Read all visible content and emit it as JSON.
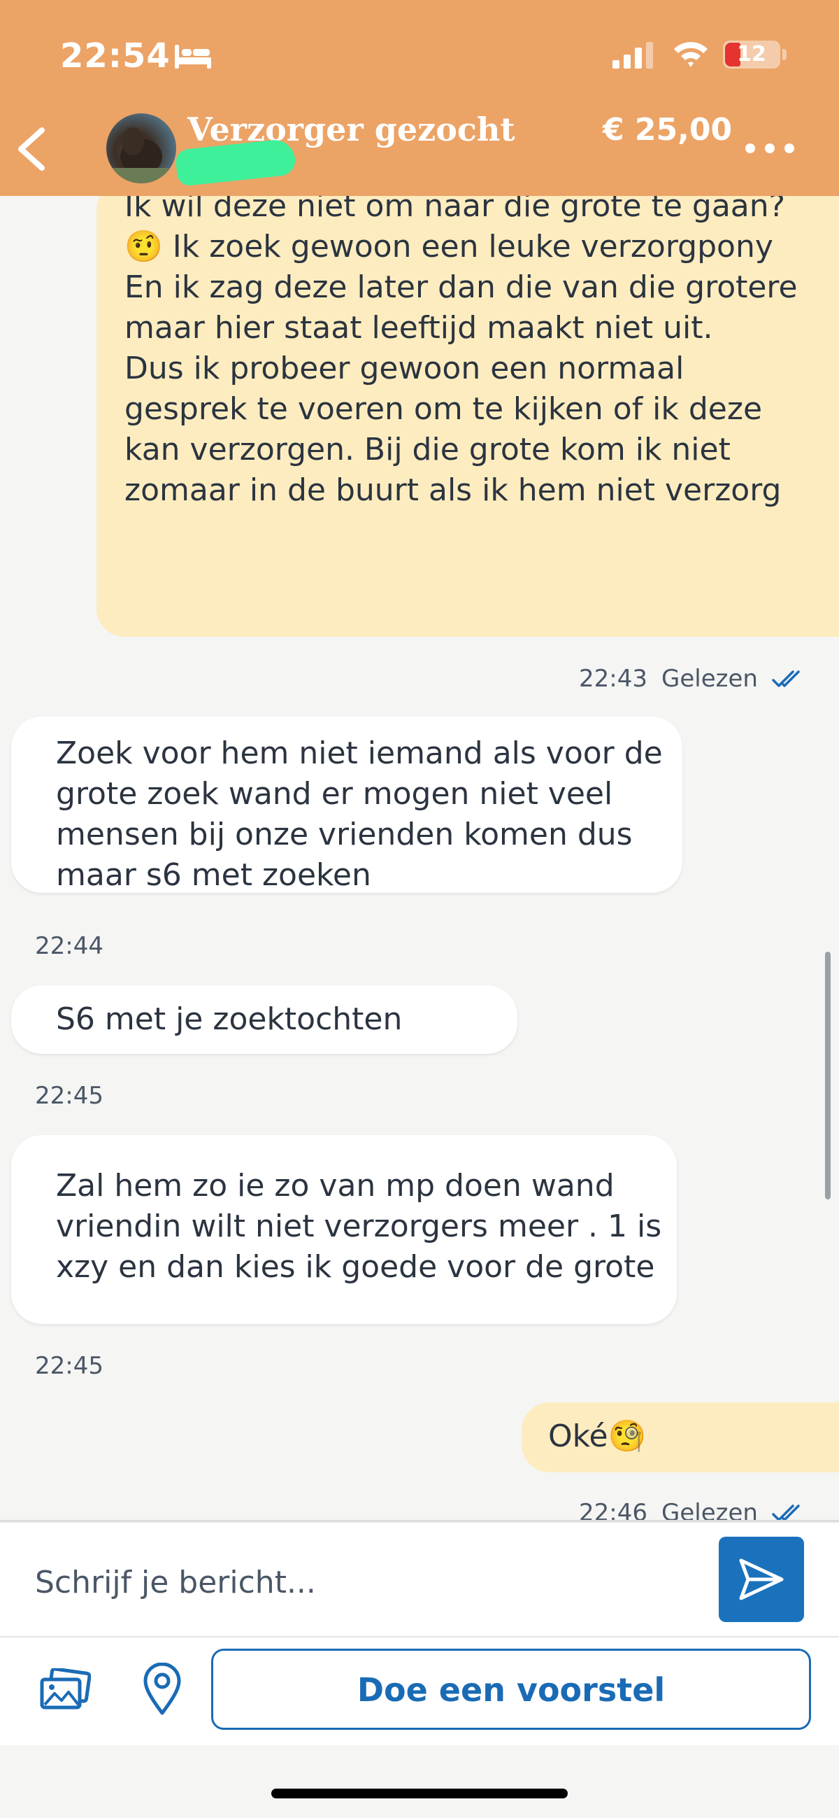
{
  "status_bar": {
    "time": "22:54",
    "battery": "12",
    "icons": [
      "bed-icon",
      "signal-icon",
      "wifi-icon",
      "battery-icon"
    ]
  },
  "header": {
    "title": "Verzorger gezocht",
    "price": "€ 25,00",
    "back_icon": "chevron-left-icon",
    "more_icon": "more-dots-icon",
    "background_color": "#eca366"
  },
  "messages": [
    {
      "direction": "outgoing",
      "text": "Ik wil deze niet om naar die grote te gaan?\n🤨 Ik zoek gewoon een leuke verzorgpony\nEn ik zag deze later dan die van die grotere\nmaar hier staat leeftijd maakt niet uit.\nDus ik probeer gewoon een normaal\ngesprek te voeren om te kijken of ik deze\nkan verzorgen. Bij die grote kom ik niet\nzomaar in de buurt als ik hem niet verzorg",
      "time": "22:43",
      "status": "Gelezen"
    },
    {
      "direction": "incoming",
      "text": "Zoek voor hem niet iemand als voor de\ngrote zoek wand er mogen niet veel\nmensen bij onze vrienden komen dus\nmaar s6 met zoeken",
      "time": "22:44"
    },
    {
      "direction": "incoming",
      "text": "S6 met je zoektochten",
      "time": "22:45"
    },
    {
      "direction": "incoming",
      "text": "Zal hem zo ie zo van mp doen wand\nvriendin wilt niet verzorgers meer . 1 is\nxzy en dan kies ik goede voor de grote",
      "time": "22:45"
    },
    {
      "direction": "outgoing",
      "text": "Oké🧐",
      "time": "22:46",
      "status": "Gelezen"
    }
  ],
  "composer": {
    "placeholder": "Schrijf je bericht...",
    "send_icon": "send-icon",
    "image_icon": "image-icon",
    "location_icon": "location-pin-icon",
    "offer_button": "Doe een voorstel",
    "accent_color": "#1a6bb5"
  },
  "colors": {
    "outgoing_bubble": "#fdecbf",
    "incoming_bubble": "#ffffff",
    "chat_background": "#f5f5f4"
  }
}
